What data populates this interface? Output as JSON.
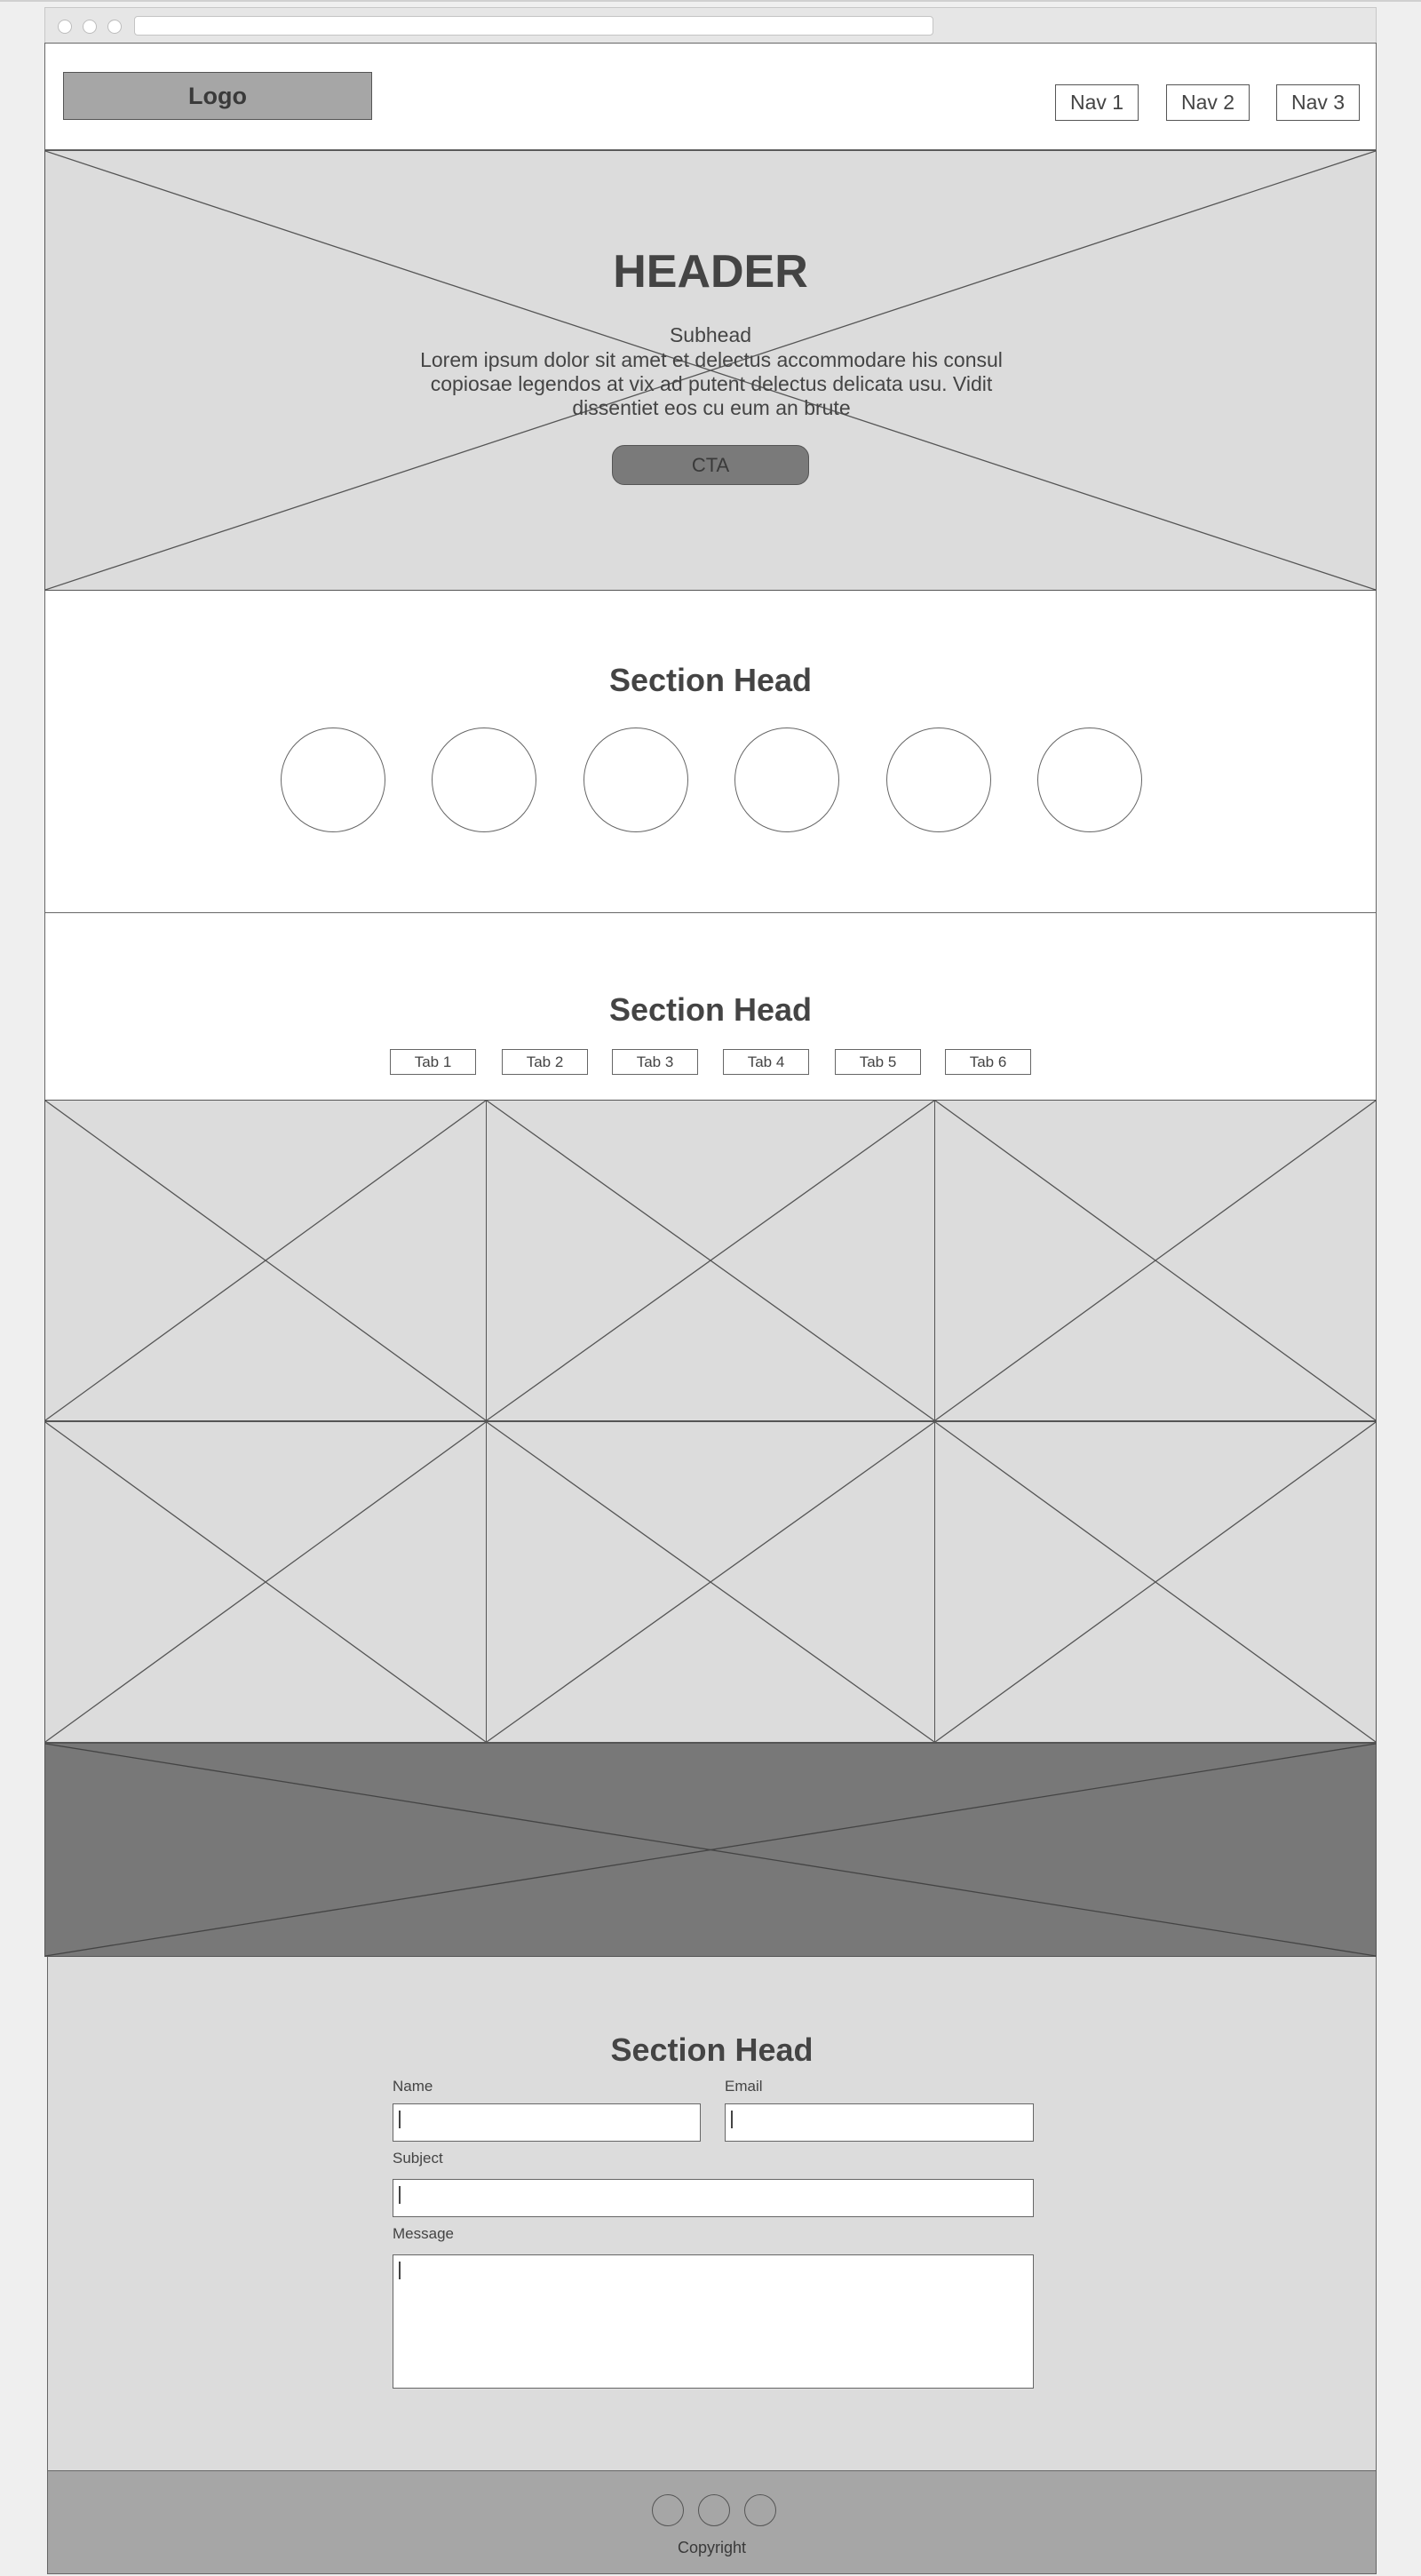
{
  "header": {
    "logo": "Logo",
    "nav": [
      "Nav 1",
      "Nav 2",
      "Nav 3"
    ]
  },
  "hero": {
    "title": "HEADER",
    "subhead": "Subhead",
    "body": "Lorem ipsum dolor sit amet et delectus accommodare his consul copiosae legendos at vix ad putent delectus delicata usu. Vidit dissentiet eos cu eum an brute",
    "cta": "CTA"
  },
  "features": {
    "title": "Section Head"
  },
  "gallery": {
    "title": "Section Head",
    "tabs": [
      "Tab 1",
      "Tab 2",
      "Tab 3",
      "Tab 4",
      "Tab 5",
      "Tab 6"
    ]
  },
  "contact": {
    "title": "Section Head",
    "name_label": "Name",
    "email_label": "Email",
    "subject_label": "Subject",
    "message_label": "Message"
  },
  "footer": {
    "copyright": "Copyright"
  },
  "colors": {
    "placeholder_fill": "#dcdcdc",
    "dark_fill": "#787878",
    "footer_fill": "#a6a6a6",
    "stroke": "#555555"
  }
}
